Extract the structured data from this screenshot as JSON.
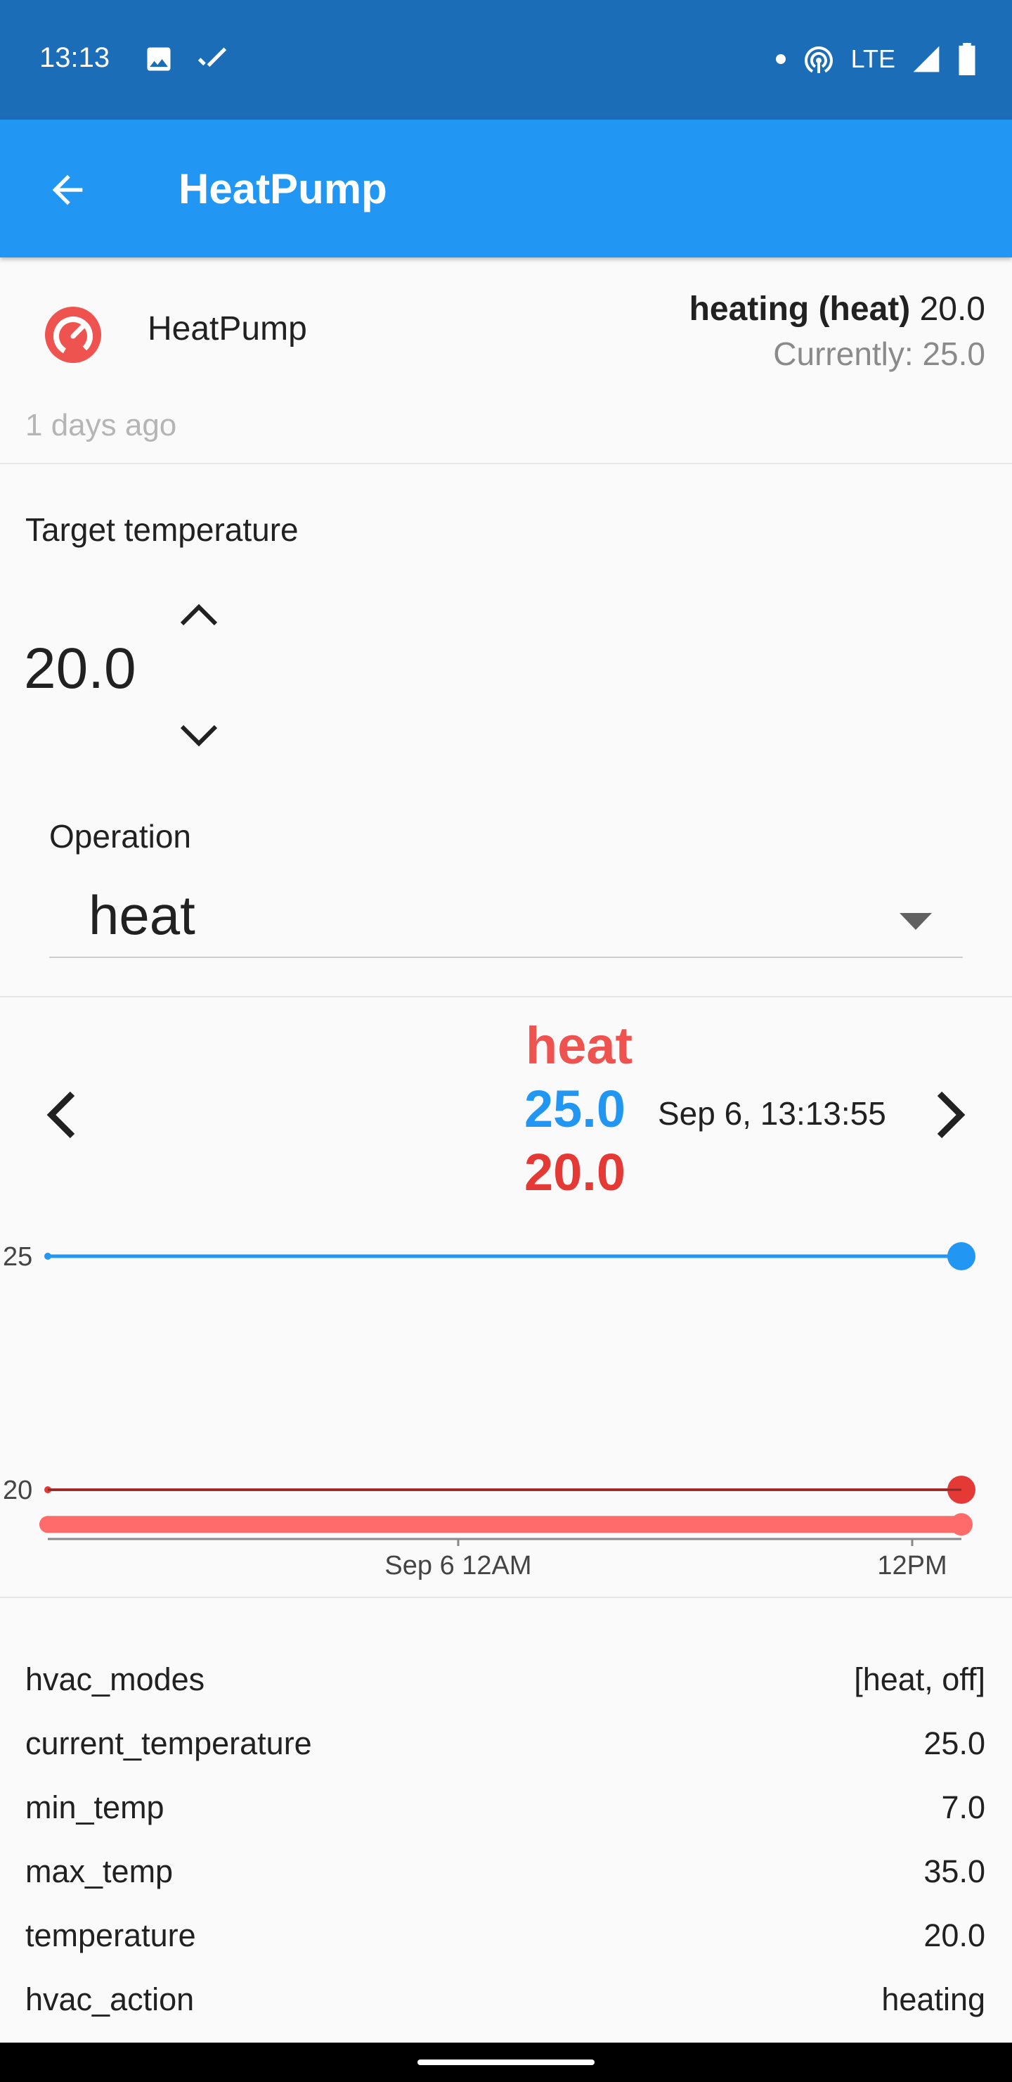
{
  "status_bar": {
    "time": "13:13",
    "network": "LTE"
  },
  "app_bar": {
    "title": "HeatPump"
  },
  "entity": {
    "name": "HeatPump",
    "state_bold": "heating (heat)",
    "state_value": " 20.0",
    "current": "Currently: 25.0",
    "last_changed": "1 days ago",
    "icon_color": "#ef5350"
  },
  "target": {
    "label": "Target temperature",
    "value": "20.0"
  },
  "operation": {
    "label": "Operation",
    "value": "heat"
  },
  "history": {
    "mode": "heat",
    "current": "25.0",
    "target": "20.0",
    "timestamp": "Sep 6, 13:13:55"
  },
  "chart_data": {
    "type": "line",
    "x_ticks": [
      "Sep 6 12AM",
      "12PM"
    ],
    "y_ticks": [
      "25",
      "20"
    ],
    "series": [
      {
        "color": "#2196f3",
        "values": [
          25,
          25
        ]
      },
      {
        "color": "#e53935",
        "values": [
          20,
          20
        ]
      },
      {
        "color": "#ff6b6b",
        "values": [
          19.8,
          19.8
        ]
      }
    ]
  },
  "attributes": [
    {
      "key": "hvac_modes",
      "value": "[heat, off]"
    },
    {
      "key": "current_temperature",
      "value": "25.0"
    },
    {
      "key": "min_temp",
      "value": "7.0"
    },
    {
      "key": "max_temp",
      "value": "35.0"
    },
    {
      "key": "temperature",
      "value": "20.0"
    },
    {
      "key": "hvac_action",
      "value": "heating"
    }
  ]
}
